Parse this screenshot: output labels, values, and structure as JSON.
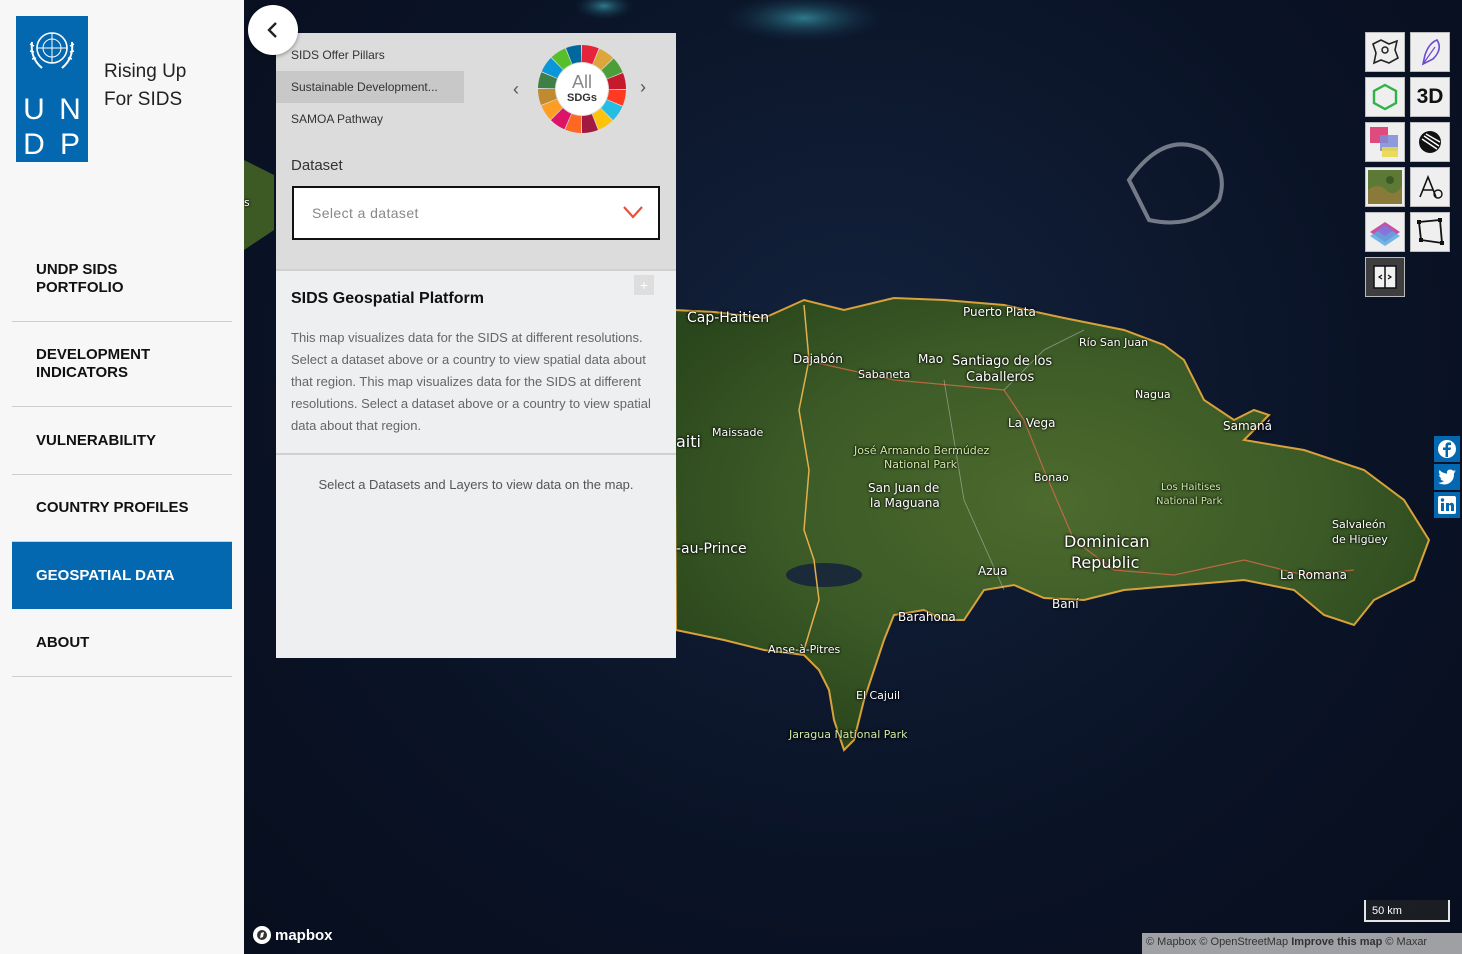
{
  "brand": {
    "logo_letters": [
      "U",
      "N",
      "D",
      "P"
    ],
    "tagline_line1": "Rising Up",
    "tagline_line2": "For SIDS"
  },
  "nav": {
    "items": [
      {
        "label": "UNDP SIDS PORTFOLIO"
      },
      {
        "label": "DEVELOPMENT INDICATORS"
      },
      {
        "label": "VULNERABILITY"
      },
      {
        "label": "COUNTRY PROFILES"
      },
      {
        "label": "GEOSPATIAL DATA",
        "active": true
      },
      {
        "label": "ABOUT"
      }
    ]
  },
  "panel": {
    "pillars": [
      {
        "label": "SIDS Offer Pillars"
      },
      {
        "label": "Sustainable Development...",
        "active": true
      },
      {
        "label": "SAMOA Pathway"
      }
    ],
    "sdg_wheel": {
      "line1": "All",
      "line2": "SDGs"
    },
    "dataset_label": "Dataset",
    "dataset_placeholder": "Select a dataset",
    "info_title": "SIDS Geospatial Platform",
    "info_body": "This map visualizes data for the SIDS at different resolutions. Select a dataset above or a country to view spatial data about that region. This map visualizes data for the SIDS at different resolutions. Select a dataset above or a country to view spatial data about that region.",
    "expand_label": "+",
    "hint": "Select a Datasets and Layers to view data on the map."
  },
  "map": {
    "labels": {
      "cap_haitien": "Cap-Haitien",
      "puerto_plata": "Puerto Plata",
      "rio_san_juan": "Río San Juan",
      "dajabon": "Dajabón",
      "mao": "Mao",
      "santiago": "Santiago de los",
      "santiago2": "Caballeros",
      "sabaneta": "Sabaneta",
      "nagua": "Nagua",
      "la_vega": "La Vega",
      "samana": "Samaná",
      "haiti": "aiti",
      "maissade": "Maissade",
      "jose_armando": "José Armando Bermúdez",
      "jose_armando2": "National Park",
      "bonao": "Bonao",
      "los_haitises": "Los Haitises",
      "los_haitises2": "National Park",
      "san_juan": "San Juan de",
      "san_juan2": "la Maguana",
      "port_au_prince": "-au-Prince",
      "dominican": "Dominican",
      "republic": "Republic",
      "salvaleon": "Salvaleón",
      "salvaleon2": "de Higüey",
      "azua": "Azua",
      "la_romana": "La Romana",
      "bani": "Baní",
      "barahona": "Barahona",
      "anse": "Anse-à-Pitres",
      "el_cajuil": "El Cajuil",
      "jaragua": "Jaragua National Park",
      "s_edge": "s"
    },
    "scale": "50 km",
    "attribution_prefix": "© Mapbox © OpenStreetMap",
    "attribution_improve": "Improve this map",
    "attribution_suffix": "© Maxar",
    "mapbox_logo": "mapbox"
  },
  "tools": {
    "three_d": "3D"
  },
  "colors": {
    "brand_blue": "#0468b1",
    "select_chevron": "#e8503a"
  }
}
